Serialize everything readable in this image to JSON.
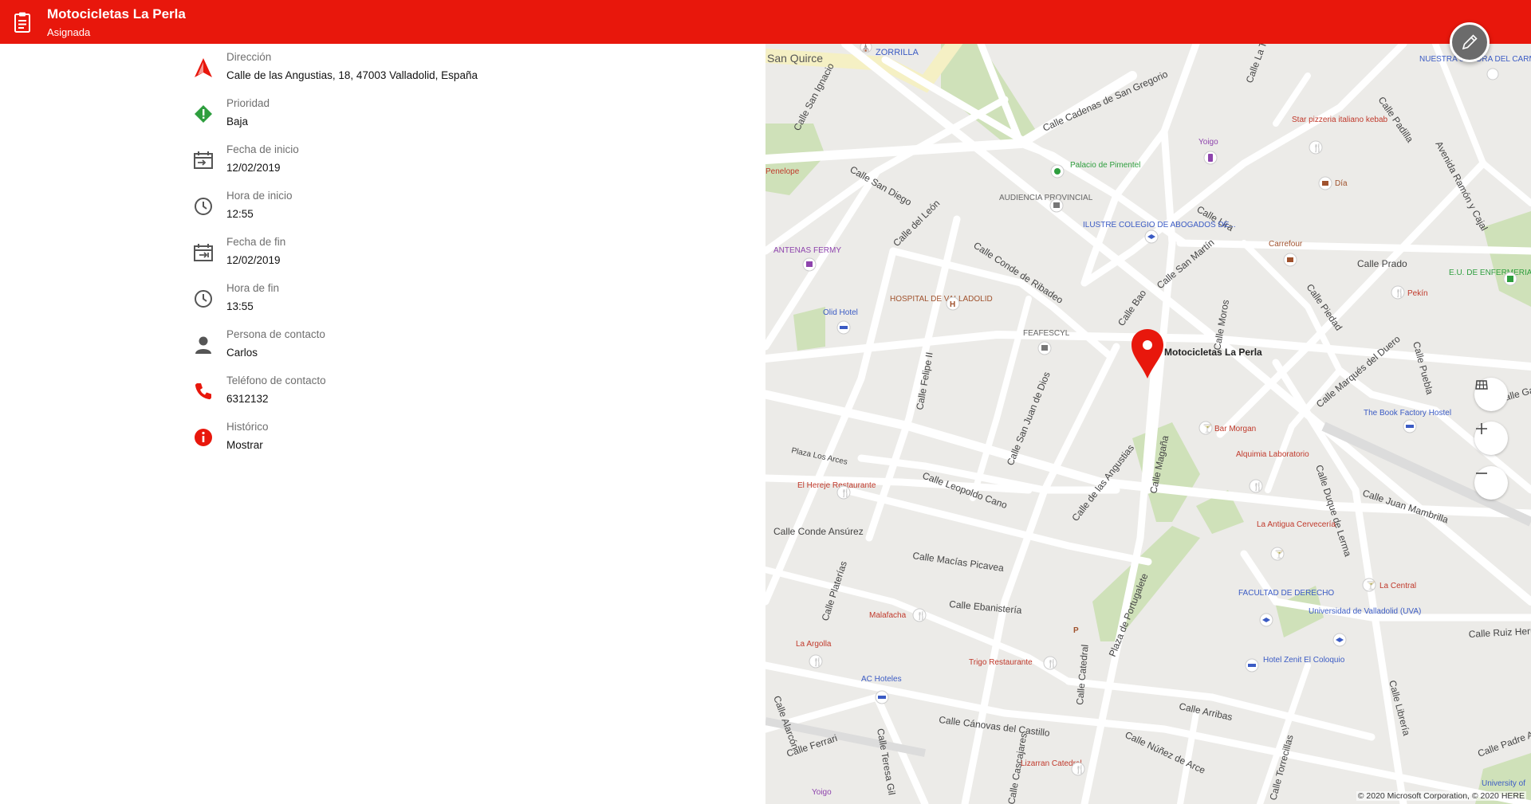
{
  "header": {
    "title": "Motocicletas La Perla",
    "subtitle": "Asignada",
    "icon": "clipboard-icon",
    "color": "#e8170c"
  },
  "fab": {
    "icon": "pencil-icon"
  },
  "details": [
    {
      "icon": "navigation-arrow-icon",
      "label": "Dirección",
      "value": "Calle de las Angustias, 18, 47003 Valladolid, España"
    },
    {
      "icon": "priority-diamond-icon",
      "label": "Prioridad",
      "value": "Baja"
    },
    {
      "icon": "calendar-start-icon",
      "label": "Fecha de inicio",
      "value": "12/02/2019"
    },
    {
      "icon": "clock-icon",
      "label": "Hora de inicio",
      "value": "12:55"
    },
    {
      "icon": "calendar-end-icon",
      "label": "Fecha de fin",
      "value": "12/02/2019"
    },
    {
      "icon": "clock-icon",
      "label": "Hora de fin",
      "value": "13:55"
    },
    {
      "icon": "person-icon",
      "label": "Persona de contacto",
      "value": "Carlos"
    },
    {
      "icon": "phone-icon",
      "label": "Teléfono de contacto",
      "value": "6312132"
    },
    {
      "icon": "info-icon",
      "label": "Histórico",
      "value": "Mostrar"
    }
  ],
  "map": {
    "pin_label": "Motocicletas La Perla",
    "copyright": "© 2020 Microsoft Corporation, © 2020 HERE",
    "streets": {
      "s1": "San Quirce",
      "s2": "Calle Cadenas de San Gregorio",
      "s3": "Calle San Ignacio",
      "s4": "Calle San Diego",
      "s5": "Calle del León",
      "s6": "Calle Conde de Ribadeo",
      "s7": "Calle San Martín",
      "s8": "Calle Lira",
      "s9": "Calle Bao",
      "s10": "Calle Moros",
      "s11": "Calle Prado",
      "s12": "Calle Piedad",
      "s13": "Calle Marqués del Duero",
      "s14": "Calle Puebla",
      "s15": "Avenida Ramón y Cajal",
      "s16": "Calle Padilla",
      "s17": "Calle La Torre",
      "s18": "Calle Felipe II",
      "s19": "Calle San Juan de Dios",
      "s20": "Calle Leopoldo Cano",
      "s21": "Calle de las Angustias",
      "s22": "Calle Magaña",
      "s23": "Calle Duque de Lerma",
      "s24": "Calle Juan Mambrilla",
      "s25": "Plaza Los Arces",
      "s26": "Calle Conde Ansúrez",
      "s27": "Calle Macías Picavea",
      "s28": "Calle Ebanistería",
      "s29": "Plaza de Portugalete",
      "s30": "Calle Platerías",
      "s31": "Calle Alarcón",
      "s32": "Calle Cánovas del Castillo",
      "s33": "Calle Arribas",
      "s34": "Calle Núñez de Arce",
      "s35": "Calle Ferrari",
      "s36": "Calle Teresa Gil",
      "s37": "Calle Catedral",
      "s38": "Calle Torrecillas",
      "s39": "Calle Librería",
      "s40": "Calle Ruiz Hernández",
      "s41": "Calle Padre Andrés",
      "s42": "Calle Gamazo",
      "s43": "Calle Cascajares",
      "s44": "Calle Conde de Ribadeo"
    },
    "pois": {
      "p1": "ZORRILLA",
      "p2": "NUESTRA SEÑORA DEL CARMEN",
      "p3": "Star pizzeria italiano kebab",
      "p4": "Yoigo",
      "p5": "Palacio de Pimentel",
      "p6": "AUDIENCIA PROVINCIAL",
      "p7": "ILUSTRE COLEGIO DE ABOGADOS DE...",
      "p8": "Día",
      "p9": "Carrefour",
      "p10": "Pekín",
      "p11": "E.U. DE ENFERMERIA",
      "p12": "ANTENAS FERMY",
      "p13": "HOSPITAL DE VALLADOLID",
      "p14": "Olid Hotel",
      "p15": "FEAFESCYL",
      "p16": "Bar Morgan",
      "p17": "The Book Factory Hostel",
      "p18": "Alquimia Laboratorio",
      "p19": "El Hereje Restaurante",
      "p20": "La Antigua Cervecería",
      "p21": "La Central",
      "p22": "FACULTAD DE DERECHO",
      "p23": "Universidad de Valladolid (UVA)",
      "p24": "Hotel Zenit El Coloquio",
      "p25": "Malafacha",
      "p26": "La Argolla",
      "p27": "Trigo Restaurante",
      "p28": "AC Hoteles",
      "p29": "Lizarran Catedral",
      "p30": "Yoigo",
      "p31": "Penelope",
      "p32": "University of",
      "p33": "P"
    }
  }
}
